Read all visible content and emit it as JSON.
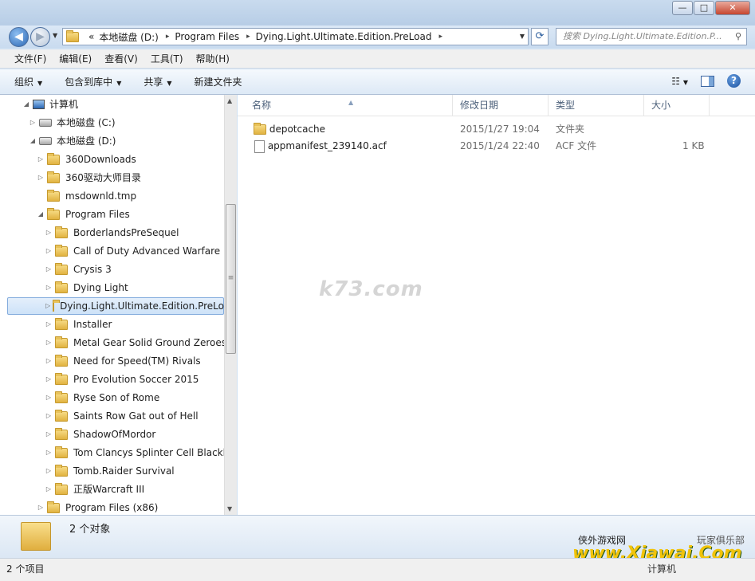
{
  "window": {
    "minimize": "—",
    "maximize": "□",
    "close": "✕"
  },
  "address": {
    "segments": [
      "«",
      "本地磁盘 (D:)",
      "Program Files",
      "Dying.Light.Ultimate.Edition.PreLoad"
    ],
    "search_placeholder": "搜索 Dying.Light.Ultimate.Edition.P..."
  },
  "menu": [
    "文件(F)",
    "编辑(E)",
    "查看(V)",
    "工具(T)",
    "帮助(H)"
  ],
  "toolbar": {
    "organize": "组织",
    "include": "包含到库中",
    "share": "共享",
    "new_folder": "新建文件夹",
    "views": "☷"
  },
  "nav": {
    "computer": "计算机",
    "drive_c": "本地磁盘 (C:)",
    "drive_d": "本地磁盘 (D:)",
    "d_items": [
      "360Downloads",
      "360驱动大师目录",
      "msdownld.tmp",
      "Program Files"
    ],
    "pf_items": [
      "BorderlandsPreSequel",
      "Call of Duty Advanced Warfare",
      "Crysis 3",
      "Dying Light",
      "Dying.Light.Ultimate.Edition.PreLoad",
      "Installer",
      "Metal Gear Solid Ground Zeroes",
      "Need for Speed(TM) Rivals",
      "Pro Evolution Soccer 2015",
      "Ryse Son of Rome",
      "Saints Row Gat out of Hell",
      "ShadowOfMordor",
      "Tom Clancys Splinter Cell Blacklist",
      "Tomb.Raider Survival",
      "正版Warcraft III"
    ],
    "pf86": "Program Files (x86)"
  },
  "columns": {
    "name": "名称",
    "modified": "修改日期",
    "type": "类型",
    "size": "大小"
  },
  "files": [
    {
      "name": "depotcache",
      "modified": "2015/1/27 19:04",
      "type": "文件夹",
      "size": ""
    },
    {
      "name": "appmanifest_239140.acf",
      "modified": "2015/1/24 22:40",
      "type": "ACF 文件",
      "size": "1 KB"
    }
  ],
  "watermark": "k73.com",
  "details": {
    "count": "2 个对象",
    "brand_left": "侠外游戏网",
    "brand_right": "玩家俱乐部",
    "logo": "www.Xiawai.Com"
  },
  "status": {
    "items": "2 个项目",
    "location": "计算机"
  }
}
